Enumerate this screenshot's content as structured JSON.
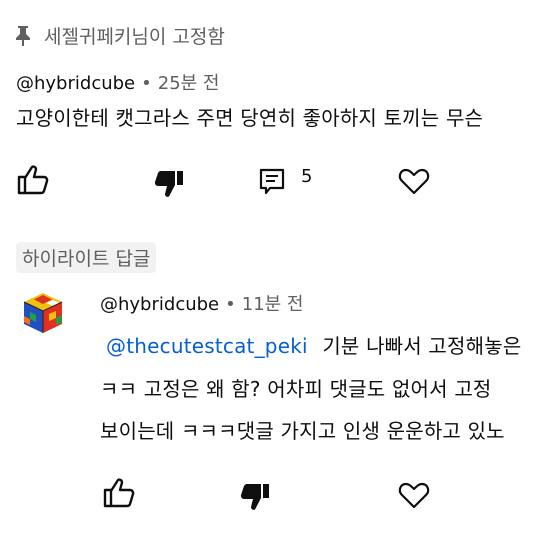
{
  "pinned": {
    "text": "세젤귀페키님이 고정함"
  },
  "comment1": {
    "author": "@hybridcube",
    "time": "25분 전",
    "text": "고양이한테 캣그라스 주면 당연히 좋아하지 토끼는 무슨",
    "reply_count": "5"
  },
  "highlight_chip": "하이라이트 답글",
  "reply": {
    "author": "@hybridcube",
    "time": "11분 전",
    "mention": "@thecutestcat_peki",
    "line1_rest": "기분 나빠서 고정해놓은",
    "line2": "ㅋㅋ 고정은 왜 함? 어차피 댓글도 없어서 고정",
    "line3": "보이는데 ㅋㅋㅋ댓글 가지고 인생 운운하고 있노"
  },
  "icons": {
    "pin": "pin-icon",
    "like": "thumbs-up-icon",
    "dislike": "thumbs-down-icon",
    "reply": "comment-icon",
    "heart": "heart-icon",
    "avatar": "rubiks-cube-avatar"
  },
  "colors": {
    "secondary_text": "#606060",
    "link": "#065fd4",
    "chip_bg": "#f2f2f2"
  }
}
